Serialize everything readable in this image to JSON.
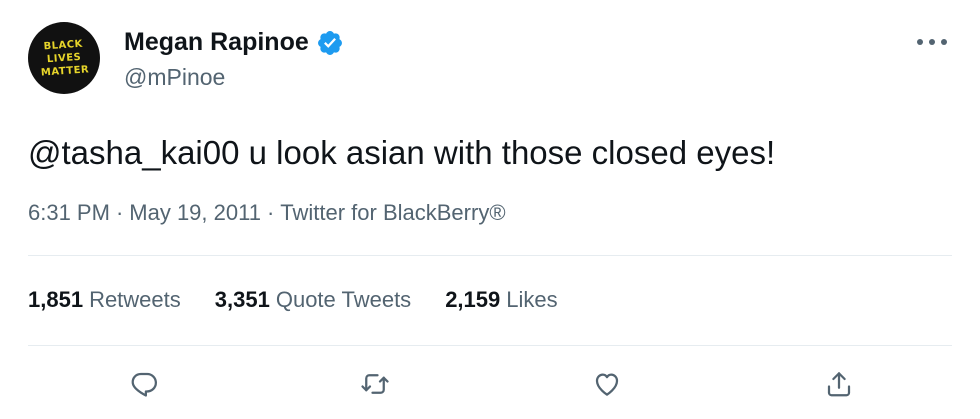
{
  "avatar": {
    "lines": [
      "BLACK",
      "LIVES",
      "MATTER"
    ]
  },
  "author": {
    "name": "Megan Rapinoe",
    "handle": "@mPinoe",
    "verified": true
  },
  "more_icon": "more-horizontal-icon",
  "tweet": {
    "text": "@tasha_kai00 u look asian with those closed eyes!"
  },
  "meta": {
    "time": "6:31 PM",
    "separator": "·",
    "date": "May 19, 2011",
    "source": "Twitter for BlackBerry®"
  },
  "stats": [
    {
      "count": "1,851",
      "label": "Retweets"
    },
    {
      "count": "3,351",
      "label": "Quote Tweets"
    },
    {
      "count": "2,159",
      "label": "Likes"
    }
  ],
  "actions": [
    {
      "name": "reply",
      "icon": "reply-icon"
    },
    {
      "name": "retweet",
      "icon": "retweet-icon"
    },
    {
      "name": "like",
      "icon": "heart-icon"
    },
    {
      "name": "share",
      "icon": "share-icon"
    }
  ],
  "colors": {
    "text": "#0f1419",
    "secondary": "#536471",
    "verified": "#1d9bf0",
    "divider": "#e6ecf0",
    "avatar_text": "#e7d52a"
  }
}
